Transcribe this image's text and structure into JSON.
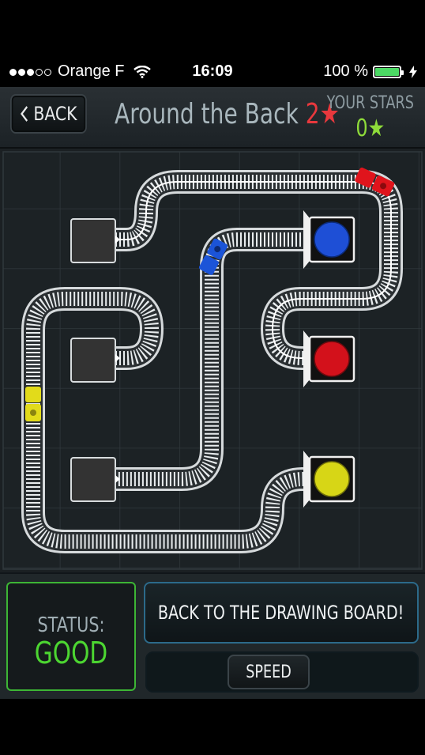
{
  "status_bar": {
    "carrier": "Orange F",
    "signal_bars_filled": 3,
    "signal_bars_total": 5,
    "time": "16:09",
    "battery": "100 %",
    "icons": [
      "wifi-icon",
      "battery-icon",
      "charging-bolt-icon"
    ]
  },
  "header": {
    "back_label": "BACK",
    "title": "Around the Back",
    "level_number": "2",
    "star_glyph": "★",
    "your_stars_label": "YOUR STARS",
    "your_stars_value": "0★"
  },
  "board": {
    "tunnels": [
      {
        "name": "tunnel-top"
      },
      {
        "name": "tunnel-middle"
      },
      {
        "name": "tunnel-bottom"
      }
    ],
    "stations": [
      {
        "name": "station-blue",
        "color": "#1e4fd6"
      },
      {
        "name": "station-red",
        "color": "#d3111b"
      },
      {
        "name": "station-yellow",
        "color": "#d7d616"
      }
    ],
    "trains": [
      {
        "name": "train-red",
        "color": "#e0141c"
      },
      {
        "name": "train-blue",
        "color": "#1b54d8"
      },
      {
        "name": "train-yellow",
        "color": "#e2db1a"
      }
    ]
  },
  "footer": {
    "status_label": "STATUS:",
    "status_value": "GOOD",
    "drawing_board_label": "BACK TO THE DRAWING BOARD!",
    "speed_label": "SPEED"
  },
  "colors": {
    "accent_green": "#4cd631",
    "title_red": "#e8383d",
    "stars_green": "#8edb3a",
    "button_border_blue": "#2c6a8a"
  }
}
